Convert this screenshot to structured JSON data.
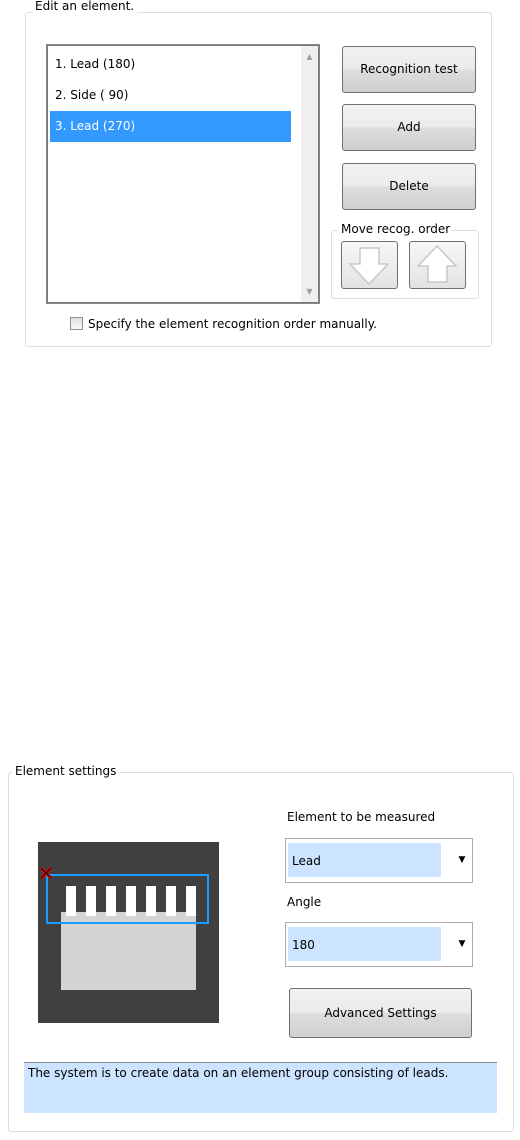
{
  "edit_group": {
    "title": "Edit an element.",
    "list_items": [
      {
        "label": "1. Lead (180)"
      },
      {
        "label": "2. Side ( 90)"
      },
      {
        "label": "3. Lead (270)"
      }
    ],
    "selected_index": 2,
    "recognition_test_label": "Recognition test",
    "add_label": "Add",
    "delete_label": "Delete",
    "move_order_title": "Move recog. order",
    "manual_order_label": "Specify the element recognition order manually.",
    "manual_order_checked": false
  },
  "settings_group": {
    "title": "Element settings",
    "element_label": "Element to be measured",
    "element_value": "Lead",
    "angle_label": "Angle",
    "angle_value": "180",
    "advanced_label": "Advanced Settings",
    "description": "The system is to create data on an element group consisting of leads."
  },
  "colors": {
    "selection": "#3399ff",
    "field_highlight": "#cce4ff",
    "preview_bg": "#404040",
    "roi_outline": "#1e9bff",
    "handle": "#ff0000"
  }
}
